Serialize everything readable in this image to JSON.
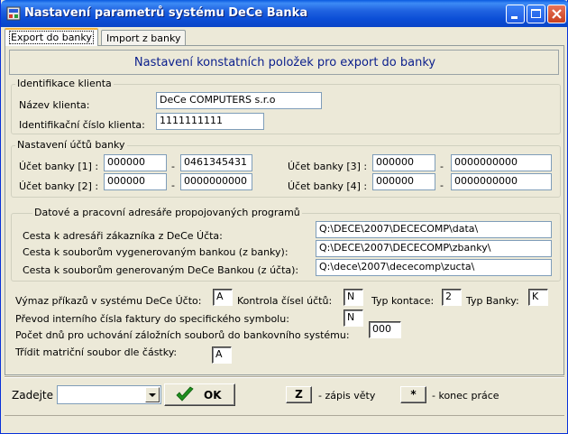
{
  "window": {
    "title": "Nastavení parametrů systému DeCe Banka"
  },
  "tabs": [
    {
      "label": "Export do banky",
      "active": true
    },
    {
      "label": "Import z banky",
      "active": false
    }
  ],
  "header": {
    "title": "Nastavení konstatních položek pro export do banky"
  },
  "client": {
    "legend": "Identifikace klienta",
    "name_label": "Název klienta:",
    "name_value": "DeCe COMPUTERS s.r.o",
    "id_label": "Identifikační číslo klienta:",
    "id_value": "1111111111"
  },
  "accounts": {
    "legend": "Nastavení účtů banky",
    "dash": "-",
    "items": [
      {
        "label": "Účet banky [1] :",
        "prefix": "000000",
        "number": "0461345431"
      },
      {
        "label": "Účet banky [2] :",
        "prefix": "000000",
        "number": "0000000000"
      },
      {
        "label": "Účet banky [3] :",
        "prefix": "000000",
        "number": "0000000000"
      },
      {
        "label": "Účet banky [4] :",
        "prefix": "000000",
        "number": "0000000000"
      }
    ]
  },
  "dirs": {
    "legend": "Datové a pracovní adresáře propojovaných programů",
    "items": [
      {
        "label": "Cesta k adresáři zákazníka z DeCe Účta:",
        "value": "Q:\\DECE\\2007\\DECECOMP\\data\\"
      },
      {
        "label": "Cesta k souborům vygenerovaným bankou (z banky):",
        "value": "Q:\\DECE\\2007\\DECECOMP\\zbanky\\"
      },
      {
        "label": "Cesta k souborům generovaným DeCe Bankou (z účta):",
        "value": "Q:\\dece\\2007\\dececomp\\zucta\\"
      }
    ]
  },
  "options": {
    "export_label": "Výmaz příkazů v systému DeCe Účto:",
    "export_value": "A",
    "check_label": "Kontrola čísel účtů:",
    "check_value": "N",
    "contact_label": "Typ kontace:",
    "contact_value": "2",
    "bank_type_label": "Typ Banky:",
    "bank_type_value": "K",
    "invoice_label": "Převod interního čísla faktury do specifického symbolu:",
    "invoice_value": "N",
    "days_label": "Počet dnů pro uchování záložních souborů do bankovního systému:",
    "days_value": "000",
    "sort_label": "Třídit matriční soubor dle částky:",
    "sort_value": "A"
  },
  "bottom": {
    "enter_label": "Zadejte",
    "combo_value": "",
    "ok_label": "OK",
    "z_key": "Z",
    "z_desc": "- zápis věty",
    "star_key": "*",
    "star_desc": "- konec práce"
  },
  "colors": {
    "titlebar": "#0a4ed6",
    "header_text": "#0a1e8c",
    "ok_check": "#1e8f1e"
  }
}
